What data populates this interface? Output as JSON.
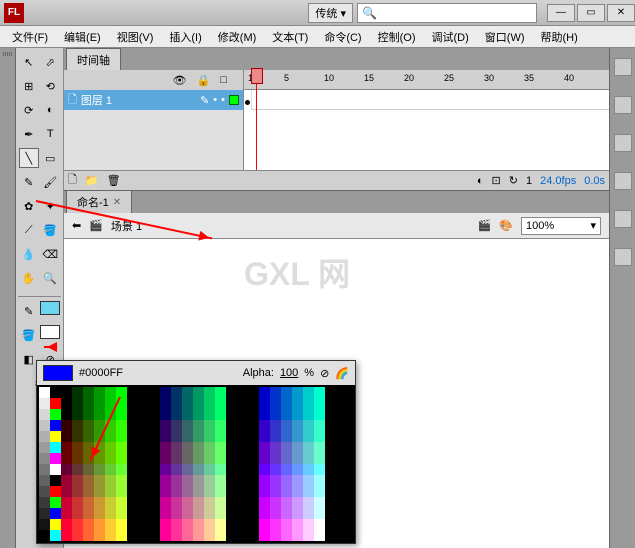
{
  "title_dropdown": "传统 ▾",
  "menus": [
    "文件(F)",
    "编辑(E)",
    "视图(V)",
    "插入(I)",
    "修改(M)",
    "文本(T)",
    "命令(C)",
    "控制(O)",
    "调试(D)",
    "窗口(W)",
    "帮助(H)"
  ],
  "timeline": {
    "tab": "时间轴",
    "layer_name": "图层 1",
    "ruler_marks": [
      "1",
      "5",
      "10",
      "15",
      "20",
      "25",
      "30",
      "35",
      "40"
    ],
    "footer": {
      "frame": "1",
      "fps": "24.0fps",
      "time": "0.0s"
    }
  },
  "doc_tab": "命名-1",
  "scene_label": "场景 1",
  "zoom": "100%",
  "watermark": "GXL 网",
  "color_picker": {
    "hex": "#0000FF",
    "alpha_label": "Alpha:",
    "alpha_value": "100",
    "alpha_pct": "%"
  },
  "icons": {
    "minimize": "—",
    "restore": "▭",
    "close": "✕",
    "eye": "👁",
    "lock": "🔒",
    "outline": "□",
    "pencil": "✎",
    "dot": "•",
    "arrow": "↖",
    "subsel": "⬀",
    "lasso": "⟲",
    "transform": "⊞",
    "pen": "✒",
    "text": "T",
    "line": "╲",
    "rect": "▭",
    "brush": "🖌",
    "deco": "✿",
    "bone": "⟋",
    "paint": "🪣",
    "eyedrop": "💧",
    "eraser": "⌫",
    "hand": "✋",
    "zoom": "🔍",
    "no": "⊘",
    "swap": "⇄",
    "chevron": "▾",
    "film": "🎬",
    "palette": "🎨"
  }
}
